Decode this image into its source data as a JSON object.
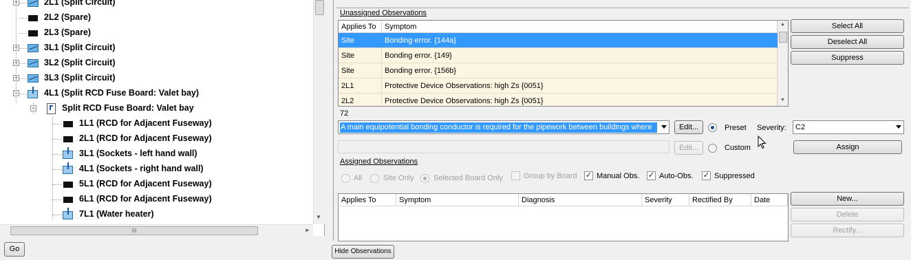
{
  "tree": {
    "items": [
      {
        "label": "2L1 (Split Circuit)",
        "icon": "split-circuit-icon",
        "expander": "+"
      },
      {
        "label": "2L2 (Spare)",
        "icon": "spare-circuit-icon",
        "expander": ""
      },
      {
        "label": "2L3 (Spare)",
        "icon": "spare-circuit-icon",
        "expander": ""
      },
      {
        "label": "3L1 (Split Circuit)",
        "icon": "split-circuit-icon",
        "expander": "+"
      },
      {
        "label": "3L2 (Split Circuit)",
        "icon": "split-circuit-icon",
        "expander": "+"
      },
      {
        "label": "3L3 (Split Circuit)",
        "icon": "split-circuit-icon",
        "expander": "+"
      },
      {
        "label": "4L1 (Split RCD Fuse Board: Valet bay)",
        "icon": "board-circuit-icon",
        "expander": "−"
      },
      {
        "label": "Split RCD Fuse Board: Valet bay",
        "icon": "fuse-board-icon",
        "expander": "−"
      },
      {
        "label": "1L1 (RCD for Adjacent Fuseway)",
        "icon": "spare-circuit-icon",
        "expander": ""
      },
      {
        "label": "2L1 (RCD for Adjacent Fuseway)",
        "icon": "spare-circuit-icon",
        "expander": ""
      },
      {
        "label": "3L1 (Sockets - left hand wall)",
        "icon": "board-circuit-icon",
        "expander": ""
      },
      {
        "label": "4L1 (Sockets - right hand wall)",
        "icon": "board-circuit-icon",
        "expander": ""
      },
      {
        "label": "5L1 (RCD for Adjacent Fuseway)",
        "icon": "spare-circuit-icon",
        "expander": ""
      },
      {
        "label": "6L1 (RCD for Adjacent Fuseway)",
        "icon": "spare-circuit-icon",
        "expander": ""
      },
      {
        "label": "7L1 (Water heater)",
        "icon": "board-circuit-icon",
        "expander": ""
      }
    ],
    "hscroll_grip": "III"
  },
  "go_button": "Go",
  "hide_observations_button": "Hide Observations",
  "unassigned": {
    "title": "Unassigned Observations",
    "columns": [
      "Applies To",
      "Symptom"
    ],
    "rows": [
      {
        "applies_to": "Site",
        "symptom": "Bonding error. {144a}",
        "selected": true
      },
      {
        "applies_to": "Site",
        "symptom": "Bonding error. {149}",
        "selected": false
      },
      {
        "applies_to": "Site",
        "symptom": "Bonding error. {156b}",
        "selected": false
      },
      {
        "applies_to": "2L1",
        "symptom": "Protective Device Observations: high Zs {0051}",
        "selected": false
      },
      {
        "applies_to": "2L2",
        "symptom": "Protective Device Observations: high Zs {0051}",
        "selected": false
      }
    ],
    "count": "72",
    "select_all": "Select All",
    "deselect_all": "Deselect All",
    "suppress": "Suppress"
  },
  "diagnosis": {
    "preset_text": "A main equipotential bonding conductor is required for the pipework between buildings where",
    "custom_text": "",
    "edit_label": "Edit...",
    "preset_label": "Preset",
    "custom_label": "Custom",
    "preset_selected": true,
    "severity_label": "Severity:",
    "severity_value": "C2",
    "assign": "Assign"
  },
  "assigned": {
    "title": "Assigned Observations",
    "filter_all": "All",
    "filter_site_only": "Site Only",
    "filter_selected_board": "Selected Board Only",
    "group_by_board": "Group by Board",
    "manual_obs": "Manual Obs.",
    "auto_obs": "Auto-Obs.",
    "suppressed": "Suppressed",
    "manual_obs_checked": true,
    "auto_obs_checked": true,
    "suppressed_checked": true,
    "columns": [
      "Applies To",
      "Symptom",
      "Diagnosis",
      "Severity",
      "Rectified By",
      "Date"
    ],
    "rows": [],
    "new": "New...",
    "delete": "Delete",
    "rectify": "Rectify..."
  },
  "colors": {
    "selection": "#3399ff",
    "row_background": "#fcf5e2",
    "icon_blue": "#6ab4e6"
  }
}
